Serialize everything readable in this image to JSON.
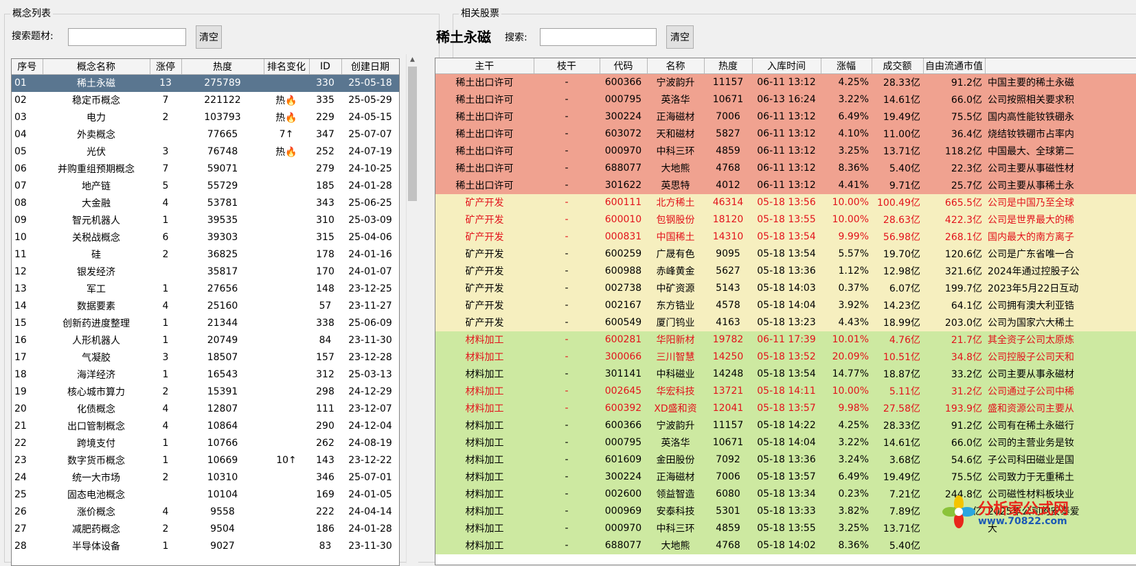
{
  "left": {
    "group_title": "概念列表",
    "search_label": "搜索题材:",
    "search_value": "",
    "clear_label": "清空",
    "columns": [
      "序号",
      "概念名称",
      "涨停",
      "热度",
      "排名变化",
      "ID",
      "创建日期"
    ],
    "rows": [
      [
        "01",
        "稀土永磁",
        "13",
        "275789",
        "",
        "330",
        "25-05-18"
      ],
      [
        "02",
        "稳定币概念",
        "7",
        "221122",
        "热🔥",
        "335",
        "25-05-29"
      ],
      [
        "03",
        "电力",
        "2",
        "103793",
        "热🔥",
        "229",
        "24-05-15"
      ],
      [
        "04",
        "外卖概念",
        "",
        "77665",
        "7↑",
        "347",
        "25-07-07"
      ],
      [
        "05",
        "光伏",
        "3",
        "76748",
        "热🔥",
        "252",
        "24-07-19"
      ],
      [
        "06",
        "并购重组预期概念",
        "7",
        "59071",
        "",
        "279",
        "24-10-25"
      ],
      [
        "07",
        "地产链",
        "5",
        "55729",
        "",
        "185",
        "24-01-28"
      ],
      [
        "08",
        "大金融",
        "4",
        "53781",
        "",
        "343",
        "25-06-25"
      ],
      [
        "09",
        "智元机器人",
        "1",
        "39535",
        "",
        "310",
        "25-03-09"
      ],
      [
        "10",
        "关税战概念",
        "6",
        "39303",
        "",
        "315",
        "25-04-06"
      ],
      [
        "11",
        "硅",
        "2",
        "36825",
        "",
        "178",
        "24-01-16"
      ],
      [
        "12",
        "银发经济",
        "",
        "35817",
        "",
        "170",
        "24-01-07"
      ],
      [
        "13",
        "军工",
        "1",
        "27656",
        "",
        "148",
        "23-12-25"
      ],
      [
        "14",
        "数据要素",
        "4",
        "25160",
        "",
        "57",
        "23-11-27"
      ],
      [
        "15",
        "创新药进度整理",
        "1",
        "21344",
        "",
        "338",
        "25-06-09"
      ],
      [
        "16",
        "人形机器人",
        "1",
        "20749",
        "",
        "84",
        "23-11-30"
      ],
      [
        "17",
        "气凝胶",
        "3",
        "18507",
        "",
        "157",
        "23-12-28"
      ],
      [
        "18",
        "海洋经济",
        "1",
        "16543",
        "",
        "312",
        "25-03-13"
      ],
      [
        "19",
        "核心城市算力",
        "2",
        "15391",
        "",
        "298",
        "24-12-29"
      ],
      [
        "20",
        "化债概念",
        "4",
        "12807",
        "",
        "111",
        "23-12-07"
      ],
      [
        "21",
        "出口管制概念",
        "4",
        "10864",
        "",
        "290",
        "24-12-04"
      ],
      [
        "22",
        "跨境支付",
        "1",
        "10766",
        "",
        "262",
        "24-08-19"
      ],
      [
        "23",
        "数字货币概念",
        "1",
        "10669",
        "10↑",
        "143",
        "23-12-22"
      ],
      [
        "24",
        "统一大市场",
        "2",
        "10310",
        "",
        "346",
        "25-07-01"
      ],
      [
        "25",
        "固态电池概念",
        "",
        "10104",
        "",
        "169",
        "24-01-05"
      ],
      [
        "26",
        "涨价概念",
        "4",
        "9558",
        "",
        "222",
        "24-04-14"
      ],
      [
        "27",
        "减肥药概念",
        "2",
        "9504",
        "",
        "186",
        "24-01-28"
      ],
      [
        "28",
        "半导体设备",
        "1",
        "9027",
        "",
        "83",
        "23-11-30"
      ]
    ]
  },
  "right": {
    "group_title": "相关股票",
    "stock_title": "稀土永磁",
    "search_label": "搜索:",
    "search_value": "",
    "clear_label": "清空",
    "columns": [
      "主干",
      "枝干",
      "代码",
      "名称",
      "热度",
      "入库时间",
      "涨幅",
      "成交额",
      "自由流通市值",
      ""
    ],
    "rows": [
      {
        "tone": "red",
        "hl": false,
        "c": [
          "稀土出口许可",
          "-",
          "600366",
          "宁波韵升",
          "11157",
          "06-11 13:12",
          "4.25%",
          "28.33亿",
          "91.2亿",
          "中国主要的稀土永磁"
        ]
      },
      {
        "tone": "red",
        "hl": false,
        "c": [
          "稀土出口许可",
          "-",
          "000795",
          "英洛华",
          "10671",
          "06-13 16:24",
          "3.22%",
          "14.61亿",
          "66.0亿",
          "公司按照相关要求积"
        ]
      },
      {
        "tone": "red",
        "hl": false,
        "c": [
          "稀土出口许可",
          "-",
          "300224",
          "正海磁材",
          "7006",
          "06-11 13:12",
          "6.49%",
          "19.49亿",
          "75.5亿",
          "国内高性能钕铁硼永"
        ]
      },
      {
        "tone": "red",
        "hl": false,
        "c": [
          "稀土出口许可",
          "-",
          "603072",
          "天和磁材",
          "5827",
          "06-11 13:12",
          "4.10%",
          "11.00亿",
          "36.4亿",
          "烧结钕铁硼市占率内"
        ]
      },
      {
        "tone": "red",
        "hl": false,
        "c": [
          "稀土出口许可",
          "-",
          "000970",
          "中科三环",
          "4859",
          "06-11 13:12",
          "3.25%",
          "13.71亿",
          "118.2亿",
          "中国最大、全球第二"
        ]
      },
      {
        "tone": "red",
        "hl": false,
        "c": [
          "稀土出口许可",
          "-",
          "688077",
          "大地熊",
          "4768",
          "06-11 13:12",
          "8.36%",
          "5.40亿",
          "22.3亿",
          "公司主要从事磁性材"
        ]
      },
      {
        "tone": "red",
        "hl": false,
        "c": [
          "稀土出口许可",
          "-",
          "301622",
          "英思特",
          "4012",
          "06-11 13:12",
          "4.41%",
          "9.71亿",
          "25.7亿",
          "公司主要从事稀土永"
        ]
      },
      {
        "tone": "yellow",
        "hl": true,
        "c": [
          "矿产开发",
          "-",
          "600111",
          "北方稀土",
          "46314",
          "05-18 13:56",
          "10.00%",
          "100.49亿",
          "665.5亿",
          "公司是中国乃至全球"
        ]
      },
      {
        "tone": "yellow",
        "hl": true,
        "c": [
          "矿产开发",
          "-",
          "600010",
          "包钢股份",
          "18120",
          "05-18 13:55",
          "10.00%",
          "28.63亿",
          "422.3亿",
          "公司是世界最大的稀"
        ]
      },
      {
        "tone": "yellow",
        "hl": true,
        "c": [
          "矿产开发",
          "-",
          "000831",
          "中国稀土",
          "14310",
          "05-18 13:54",
          "9.99%",
          "56.98亿",
          "268.1亿",
          "国内最大的南方离子"
        ]
      },
      {
        "tone": "yellow",
        "hl": false,
        "c": [
          "矿产开发",
          "-",
          "600259",
          "广晟有色",
          "9095",
          "05-18 13:54",
          "5.57%",
          "19.70亿",
          "120.6亿",
          "公司是广东省唯一合"
        ]
      },
      {
        "tone": "yellow",
        "hl": false,
        "c": [
          "矿产开发",
          "-",
          "600988",
          "赤峰黄金",
          "5627",
          "05-18 13:36",
          "1.12%",
          "12.98亿",
          "321.6亿",
          "2024年通过控股子公"
        ]
      },
      {
        "tone": "yellow",
        "hl": false,
        "c": [
          "矿产开发",
          "-",
          "002738",
          "中矿资源",
          "5143",
          "05-18 14:03",
          "0.37%",
          "6.07亿",
          "199.7亿",
          "2023年5月22日互动"
        ]
      },
      {
        "tone": "yellow",
        "hl": false,
        "c": [
          "矿产开发",
          "-",
          "002167",
          "东方锆业",
          "4578",
          "05-18 14:04",
          "3.92%",
          "14.23亿",
          "64.1亿",
          "公司拥有澳大利亚锆"
        ]
      },
      {
        "tone": "yellow",
        "hl": false,
        "c": [
          "矿产开发",
          "-",
          "600549",
          "厦门钨业",
          "4163",
          "05-18 13:23",
          "4.43%",
          "18.99亿",
          "203.0亿",
          "公司为国家六大稀土"
        ]
      },
      {
        "tone": "green",
        "hl": true,
        "c": [
          "材料加工",
          "-",
          "600281",
          "华阳新材",
          "19782",
          "06-11 17:39",
          "10.01%",
          "4.76亿",
          "21.7亿",
          "其全资子公司太原炼"
        ]
      },
      {
        "tone": "green",
        "hl": true,
        "c": [
          "材料加工",
          "-",
          "300066",
          "三川智慧",
          "14250",
          "05-18 13:52",
          "20.09%",
          "10.51亿",
          "34.8亿",
          "公司控股子公司天和"
        ]
      },
      {
        "tone": "green",
        "hl": false,
        "c": [
          "材料加工",
          "-",
          "301141",
          "中科磁业",
          "14248",
          "05-18 13:54",
          "14.77%",
          "18.87亿",
          "33.2亿",
          "公司主要从事永磁材"
        ]
      },
      {
        "tone": "green",
        "hl": true,
        "c": [
          "材料加工",
          "-",
          "002645",
          "华宏科技",
          "13721",
          "05-18 14:11",
          "10.00%",
          "5.11亿",
          "31.2亿",
          "公司通过子公司中稀"
        ]
      },
      {
        "tone": "green",
        "hl": true,
        "c": [
          "材料加工",
          "-",
          "600392",
          "XD盛和资",
          "12041",
          "05-18 13:57",
          "9.98%",
          "27.58亿",
          "193.9亿",
          "盛和资源公司主要从"
        ]
      },
      {
        "tone": "green",
        "hl": false,
        "c": [
          "材料加工",
          "-",
          "600366",
          "宁波韵升",
          "11157",
          "05-18 14:22",
          "4.25%",
          "28.33亿",
          "91.2亿",
          "公司有在稀土永磁行"
        ]
      },
      {
        "tone": "green",
        "hl": false,
        "c": [
          "材料加工",
          "-",
          "000795",
          "英洛华",
          "10671",
          "05-18 14:04",
          "3.22%",
          "14.61亿",
          "66.0亿",
          "公司的主营业务是钕"
        ]
      },
      {
        "tone": "green",
        "hl": false,
        "c": [
          "材料加工",
          "-",
          "601609",
          "金田股份",
          "7092",
          "05-18 13:36",
          "3.24%",
          "3.68亿",
          "54.6亿",
          "子公司科田磁业是国"
        ]
      },
      {
        "tone": "green",
        "hl": false,
        "c": [
          "材料加工",
          "-",
          "300224",
          "正海磁材",
          "7006",
          "05-18 13:57",
          "6.49%",
          "19.49亿",
          "75.5亿",
          "公司致力于无重稀土"
        ]
      },
      {
        "tone": "green",
        "hl": false,
        "c": [
          "材料加工",
          "-",
          "002600",
          "领益智造",
          "6080",
          "05-18 13:34",
          "0.23%",
          "7.21亿",
          "244.8亿",
          "公司磁性材料板块业"
        ]
      },
      {
        "tone": "green",
        "hl": false,
        "c": [
          "材料加工",
          "-",
          "000969",
          "安泰科技",
          "5301",
          "05-18 13:33",
          "3.82%",
          "7.89亿",
          "87.0亿",
          "2025年公司的安泰爱"
        ]
      },
      {
        "tone": "green",
        "hl": false,
        "c": [
          "材料加工",
          "-",
          "000970",
          "中科三环",
          "4859",
          "05-18 13:55",
          "3.25%",
          "13.71亿",
          "",
          "大"
        ]
      },
      {
        "tone": "green",
        "hl": false,
        "c": [
          "材料加工",
          "-",
          "688077",
          "大地熊",
          "4768",
          "05-18 14:02",
          "8.36%",
          "5.40亿",
          "",
          ""
        ]
      }
    ]
  },
  "logo": {
    "text": "分析家公式网",
    "url_text": "www.70822.com",
    "colors": {
      "primary": "#e8261b",
      "secondary": "#1a59b5"
    }
  }
}
